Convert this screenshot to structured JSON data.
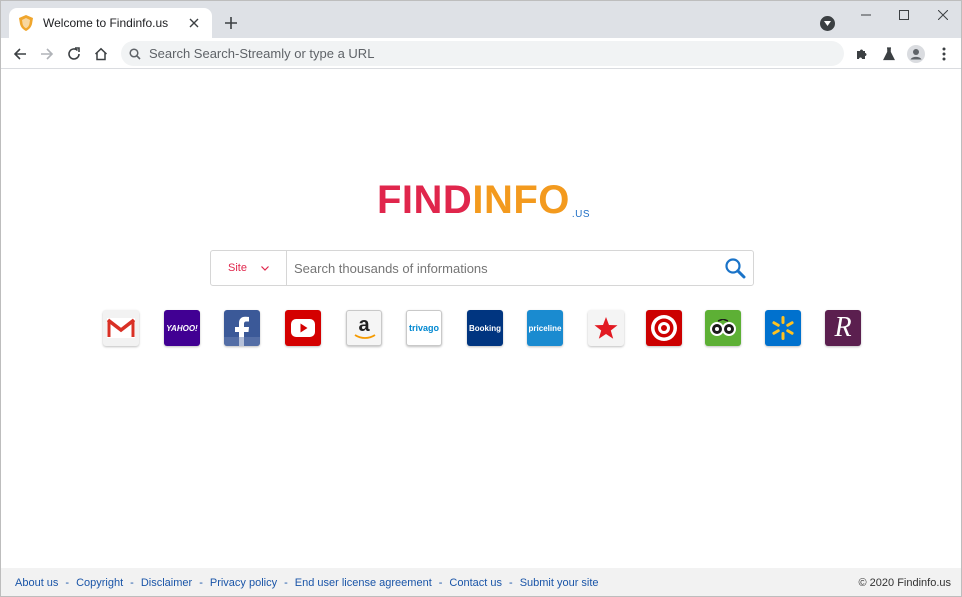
{
  "tab": {
    "title": "Welcome to Findinfo.us"
  },
  "omnibox": {
    "placeholder": "Search Search-Streamly or type a URL"
  },
  "logo": {
    "find": "FIND",
    "info": "INFO",
    "tld": ".US"
  },
  "search": {
    "scope_label": "Site",
    "placeholder": "Search thousands of informations"
  },
  "shortcuts": {
    "yahoo": "YAHOO!",
    "amazon": "a",
    "trivago": "trivago",
    "booking": "Booking",
    "priceline": "priceline",
    "rakuten": "R"
  },
  "footer": {
    "links": [
      "About us",
      "Copyright",
      "Disclaimer",
      "Privacy policy",
      "End user license agreement",
      "Contact us",
      "Submit your site"
    ],
    "copyright": "© 2020 Findinfo.us"
  },
  "colors": {
    "brand_red": "#e0264c",
    "brand_orange": "#f39a1e",
    "brand_blue": "#1f6fc5",
    "link": "#1a55a8"
  },
  "icons": [
    "shield-favicon-icon",
    "close-icon",
    "plus-icon",
    "chevron-down-icon",
    "minimize-icon",
    "maximize-icon",
    "window-close-icon",
    "back-arrow-icon",
    "forward-arrow-icon",
    "reload-icon",
    "home-icon",
    "search-icon",
    "puzzle-icon",
    "flask-icon",
    "account-icon",
    "kebab-menu-icon",
    "magnifier-icon"
  ]
}
